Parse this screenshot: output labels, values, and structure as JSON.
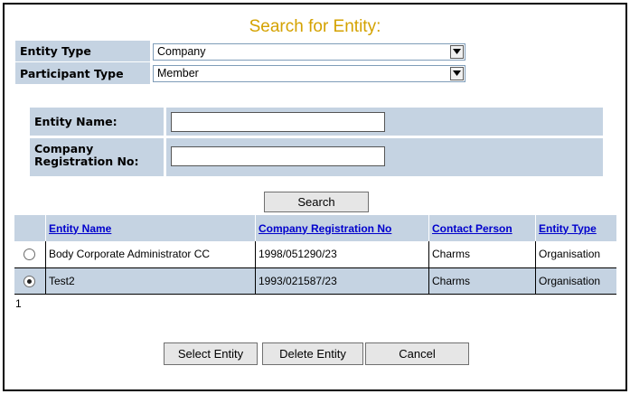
{
  "title": "Search for Entity:",
  "entity_type": {
    "label": "Entity Type",
    "value": "Company"
  },
  "participant_type": {
    "label": "Participant Type",
    "value": "Member"
  },
  "entity_name": {
    "label": "Entity Name:",
    "value": ""
  },
  "company_reg": {
    "label_line1": "Company",
    "label_line2": "Registration No:",
    "value": ""
  },
  "search_button": "Search",
  "grid": {
    "columns": [
      "Entity Name",
      "Company Registration No",
      "Contact Person",
      "Entity Type"
    ],
    "rows": [
      {
        "selected": false,
        "entity_name": "Body Corporate Administrator CC",
        "reg_no": "1998/051290/23",
        "contact": "Charms",
        "type": "Organisation"
      },
      {
        "selected": true,
        "entity_name": "Test2",
        "reg_no": "1993/021587/23",
        "contact": "Charms",
        "type": "Organisation"
      }
    ]
  },
  "pager": "1",
  "buttons": {
    "select": "Select Entity",
    "delete": "Delete Entity",
    "cancel": "Cancel"
  },
  "colors": {
    "title": "#d4a200",
    "panel": "#c5d3e2",
    "link": "#0000cc"
  }
}
